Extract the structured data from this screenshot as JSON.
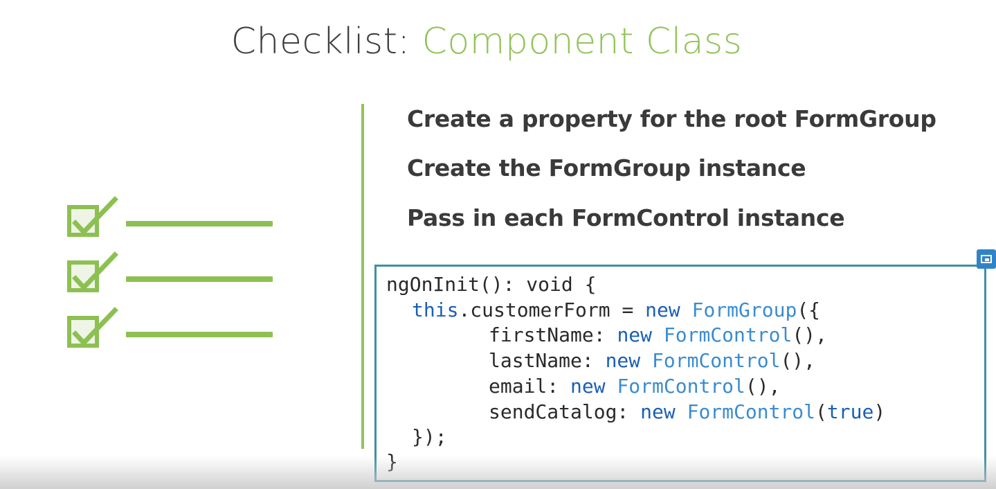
{
  "slide": {
    "title_prefix": "Checklist: ",
    "title_suffix": "Component Class",
    "bullets": [
      "Create a property for the root FormGroup",
      "Create the FormGroup instance",
      "Pass in each FormControl instance"
    ]
  },
  "code": {
    "l1_a": "ngOnInit(): void {",
    "l2_this": "this",
    "l2_a": ".customerForm = ",
    "l2_new": "new",
    "l2_sp": " ",
    "l2_cls": "FormGroup",
    "l2_end": "({",
    "l3_a": "firstName: ",
    "l3_new": "new",
    "l3_cls": "FormControl",
    "l3_end": "(),",
    "l4_a": "lastName: ",
    "l4_new": "new",
    "l4_cls": "FormControl",
    "l4_end": "(),",
    "l5_a": "email: ",
    "l5_new": "new",
    "l5_cls": "FormControl",
    "l5_end": "(),",
    "l6_a": "sendCatalog: ",
    "l6_new": "new",
    "l6_cls": "FormControl",
    "l6_open": "(",
    "l6_true": "true",
    "l6_close": ")",
    "l7_a": "});",
    "l8_a": "}"
  },
  "icons": {
    "checklist": "checklist-icon",
    "handle": "crop-handle-icon"
  },
  "colors": {
    "accent_green": "#93c35a",
    "code_border": "#3d8fa3",
    "keyword_blue": "#1a5fb4",
    "class_blue": "#3a8ccf"
  }
}
